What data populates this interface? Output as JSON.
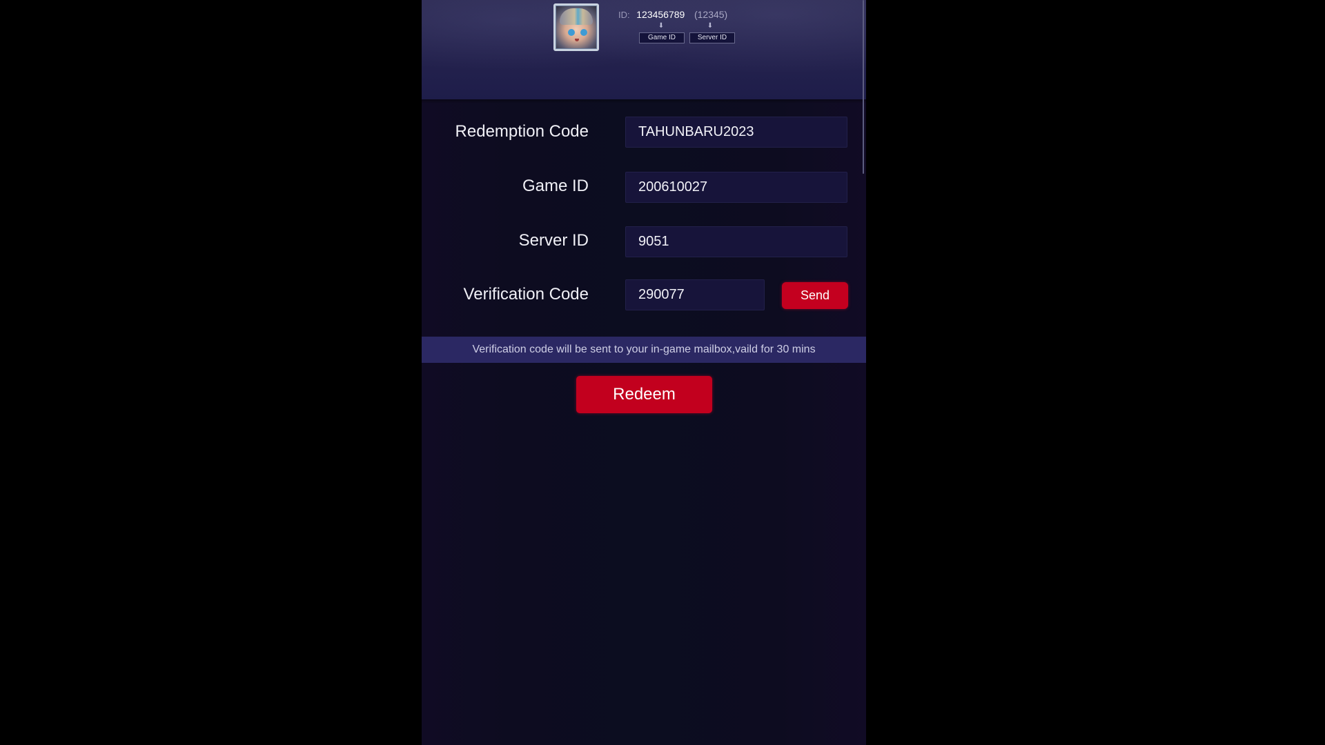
{
  "header": {
    "id_prefix": "ID:",
    "id_value": "123456789",
    "server_value": "(12345)",
    "arrow_glyph": "⬇",
    "game_id_tag": "Game ID",
    "server_id_tag": "Server ID",
    "avatar_icon": "hero-avatar-icon"
  },
  "form": {
    "fields": [
      {
        "label": "Redemption Code",
        "value": "TAHUNBARU2023"
      },
      {
        "label": "Game ID",
        "value": "200610027"
      },
      {
        "label": "Server ID",
        "value": "9051"
      },
      {
        "label": "Verification Code",
        "value": "290077"
      }
    ],
    "send_label": "Send",
    "info_text": "Verification code will be sent to your in-game mailbox,vaild for 30 mins",
    "redeem_label": "Redeem"
  },
  "colors": {
    "accent_red": "#c4001f",
    "info_bar": "#2b2863",
    "panel_bg": "#0d0c20",
    "header_bg": "#24224d"
  }
}
